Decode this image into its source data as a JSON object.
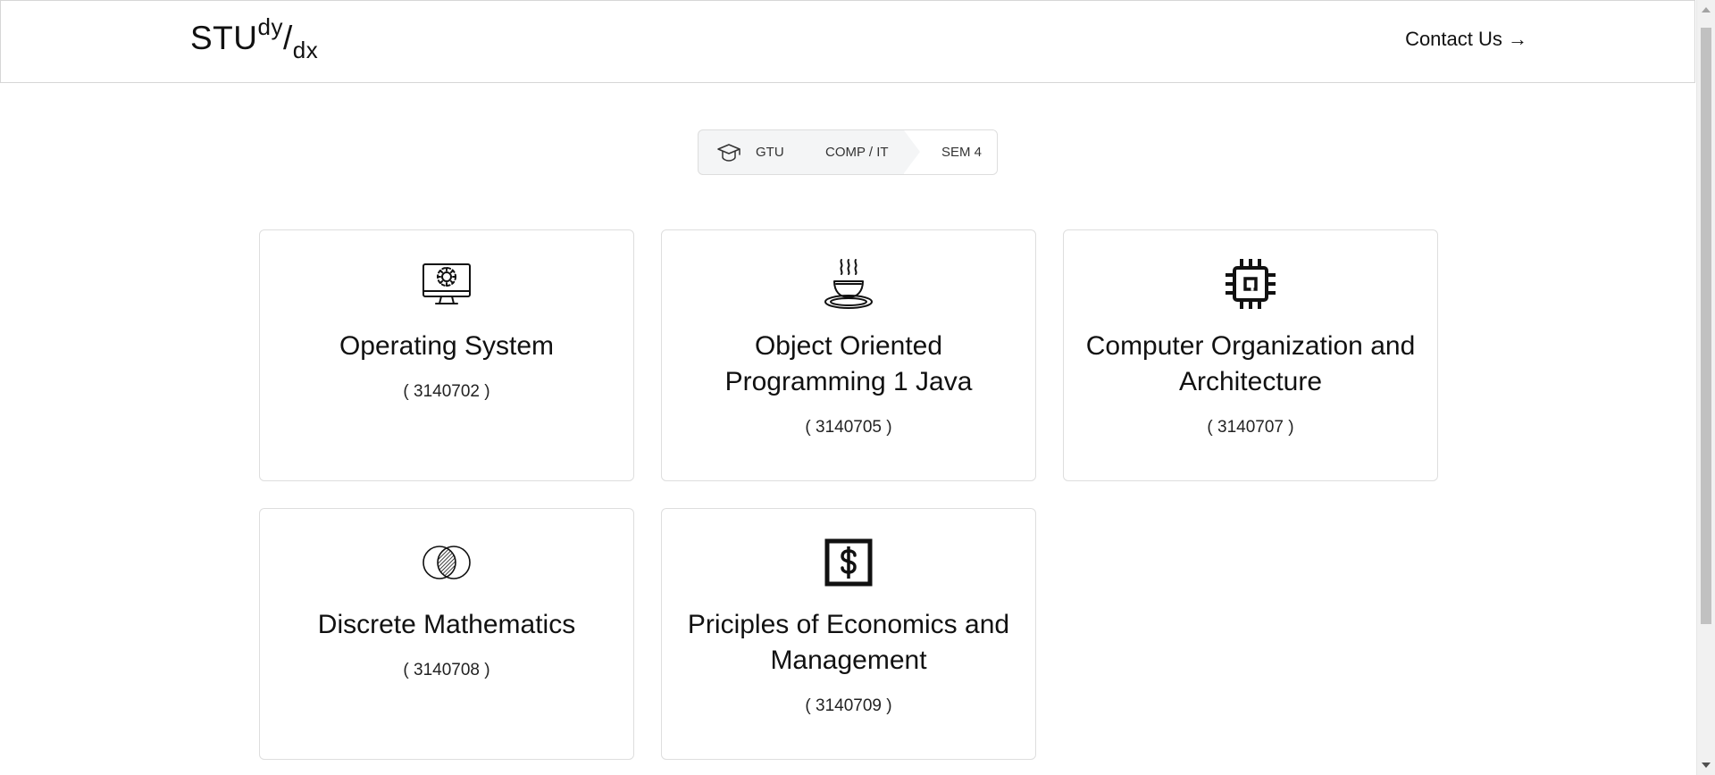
{
  "navbar": {
    "brand": {
      "base": "STU",
      "sup": "dy",
      "slash": "/",
      "sub": "dx"
    },
    "contact_label": "Contact Us →"
  },
  "breadcrumb": {
    "home_icon": "graduation-cap-icon",
    "items": [
      {
        "label": "GTU"
      },
      {
        "label": "COMP / IT"
      },
      {
        "label": "SEM 4"
      }
    ]
  },
  "subjects": [
    {
      "title": "Operating System",
      "code": "( 3140702 )",
      "icon": "monitor-gear-icon"
    },
    {
      "title": "Object Oriented Programming 1 Java",
      "code": "( 3140705 )",
      "icon": "coffee-cup-icon"
    },
    {
      "title": "Computer Organization and Architecture",
      "code": "( 3140707 )",
      "icon": "cpu-chip-icon"
    },
    {
      "title": "Discrete Mathematics",
      "code": "( 3140708 )",
      "icon": "venn-diagram-icon"
    },
    {
      "title": "Priciples of Economics and Management",
      "code": "( 3140709 )",
      "icon": "dollar-bill-icon"
    }
  ]
}
